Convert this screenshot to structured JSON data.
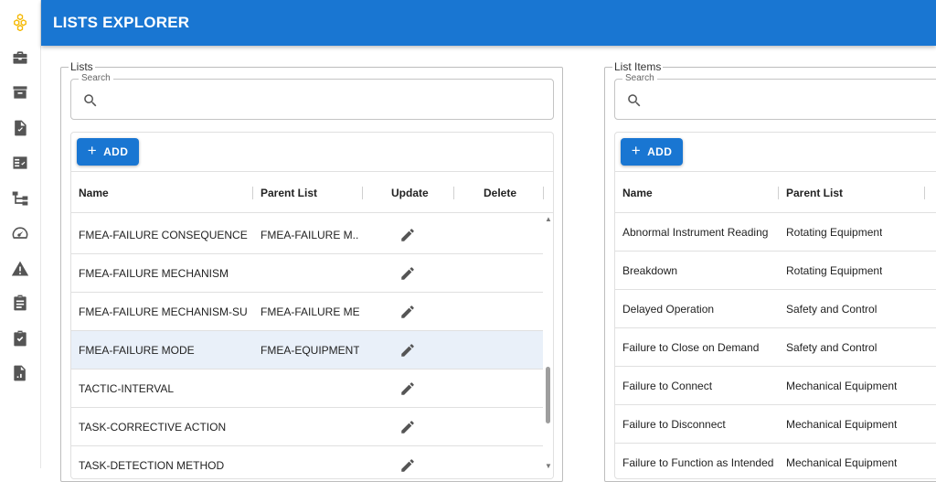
{
  "app": {
    "title": "LISTS EXPLORER",
    "accent": "#1976d2",
    "logo_color": "#f5b800"
  },
  "sidebar": {
    "items": [
      {
        "icon": "hexagon-logo-icon"
      },
      {
        "icon": "briefcase-icon"
      },
      {
        "icon": "archive-icon"
      },
      {
        "icon": "file-check-icon"
      },
      {
        "icon": "checklist-icon"
      },
      {
        "icon": "hierarchy-icon"
      },
      {
        "icon": "speedometer-icon"
      },
      {
        "icon": "warning-icon"
      },
      {
        "icon": "clipboard-icon"
      },
      {
        "icon": "clipboard-check-icon"
      },
      {
        "icon": "report-icon"
      }
    ]
  },
  "lists_panel": {
    "legend": "Lists",
    "search_label": "Search",
    "search_value": "",
    "add_label": "ADD",
    "columns": [
      "Name",
      "Parent List",
      "Update",
      "Delete"
    ],
    "rows": [
      {
        "name": "FMEA-FAILURE CONSEQUENCE",
        "parent": "FMEA-FAILURE M...",
        "selected": false
      },
      {
        "name": "FMEA-FAILURE MECHANISM",
        "parent": "",
        "selected": false
      },
      {
        "name": "FMEA-FAILURE MECHANISM-SUB",
        "parent": "FMEA-FAILURE ME...",
        "selected": false
      },
      {
        "name": "FMEA-FAILURE MODE",
        "parent": "FMEA-EQUIPMENT...",
        "selected": true
      },
      {
        "name": "TACTIC-INTERVAL",
        "parent": "",
        "selected": false
      },
      {
        "name": "TASK-CORRECTIVE ACTION",
        "parent": "",
        "selected": false
      },
      {
        "name": "TASK-DETECTION METHOD",
        "parent": "",
        "selected": false
      }
    ]
  },
  "items_panel": {
    "legend": "List Items",
    "search_label": "Search",
    "search_value": "",
    "add_label": "ADD",
    "columns": [
      "Name",
      "Parent List"
    ],
    "rows": [
      {
        "name": "Abnormal Instrument Reading",
        "parent": "Rotating Equipment"
      },
      {
        "name": "Breakdown",
        "parent": "Rotating Equipment"
      },
      {
        "name": "Delayed Operation",
        "parent": "Safety and Control"
      },
      {
        "name": "Failure to Close on Demand",
        "parent": "Safety and Control"
      },
      {
        "name": "Failure to Connect",
        "parent": "Mechanical Equipment"
      },
      {
        "name": "Failure to Disconnect",
        "parent": "Mechanical Equipment"
      },
      {
        "name": "Failure to Function as Intended",
        "parent": "Mechanical Equipment"
      }
    ]
  }
}
